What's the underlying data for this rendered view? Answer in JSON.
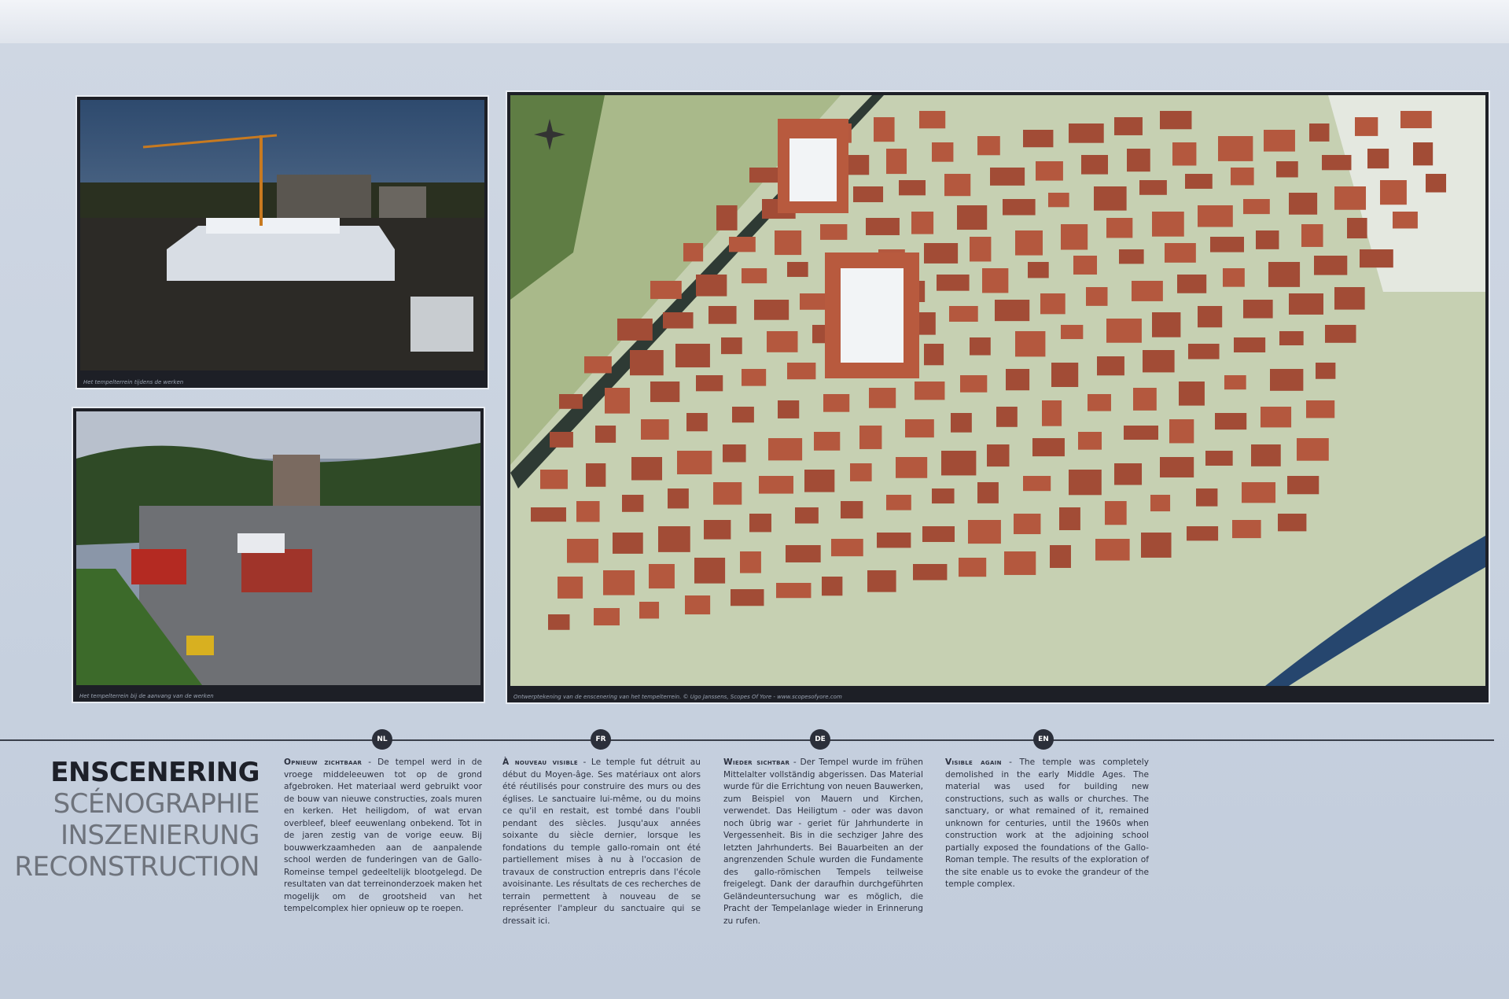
{
  "photos": [
    {
      "caption": "Het tempelterrein tijdens de werken"
    },
    {
      "caption": "Het tempelterrein bij de aanvang van de werken"
    }
  ],
  "map": {
    "caption": "Ontwerptekening van de enscenering van het tempelterrein. © Ugo Janssens, Scopes Of Yore - www.scopesofyore.com"
  },
  "languages": [
    "NL",
    "FR",
    "DE",
    "EN"
  ],
  "titles": [
    "ENSCENERING",
    "SCÉNOGRAPHIE",
    "INSZENIERUNG",
    "RECONSTRUCTION"
  ],
  "texts": [
    {
      "heading": "Opnieuw zichtbaar",
      "body": "De tempel werd in de vroege middeleeuwen tot op de grond afgebroken. Het materiaal werd gebruikt voor de bouw van nieuwe constructies, zoals muren en kerken. Het heiligdom, of wat ervan overbleef, bleef eeuwenlang onbekend. Tot in de jaren zestig van de vorige eeuw. Bij bouwwerkzaamheden aan de aanpalende school werden de funderingen van de Gallo-Romeinse tempel gedeeltelijk blootgelegd. De resultaten van dat terreinonderzoek maken het mogelijk om de grootsheid van het tempelcomplex hier opnieuw op te roepen."
    },
    {
      "heading": "À nouveau visible",
      "body": "Le temple fut détruit au début du Moyen-âge. Ses matériaux ont alors été réutilisés pour construire des murs ou des églises. Le sanctuaire lui-même, ou du moins ce qu'il en restait, est tombé dans l'oubli pendant des siècles. Jusqu'aux années soixante du siècle dernier, lorsque les fondations du temple gallo-romain ont été partiellement mises à nu à l'occasion de travaux de construction entrepris dans l'école avoisinante. Les résultats de ces recherches de terrain permettent à nouveau de se représenter l'ampleur du sanctuaire qui se dressait ici."
    },
    {
      "heading": "Wieder sichtbar",
      "body": "Der Tempel wurde im frühen Mittelalter vollständig abgerissen. Das Material wurde für die Errichtung von neuen Bauwerken, zum Beispiel von Mauern und Kirchen, verwendet. Das Heiligtum - oder was davon noch übrig war - geriet für Jahrhunderte in Vergessenheit. Bis in die sechziger Jahre des letzten Jahrhunderts. Bei Bauarbeiten an der angrenzenden Schule wurden die Fundamente des gallo-römischen Tempels teilweise freigelegt. Dank der daraufhin durchgeführten Geländeuntersuchung war es möglich, die Pracht der Tempelanlage wieder in Erinnerung zu rufen."
    },
    {
      "heading": "Visible again",
      "body": "The temple was completely demolished in the early Middle Ages. The material was used for building new constructions, such as walls or churches. The sanctuary, or what remained of it, remained unknown for centuries, until the 1960s when construction work at the adjoining school partially exposed the foundations of the Gallo-Roman temple. The results of the exploration of the site enable us to evoke the grandeur of the temple complex."
    }
  ]
}
